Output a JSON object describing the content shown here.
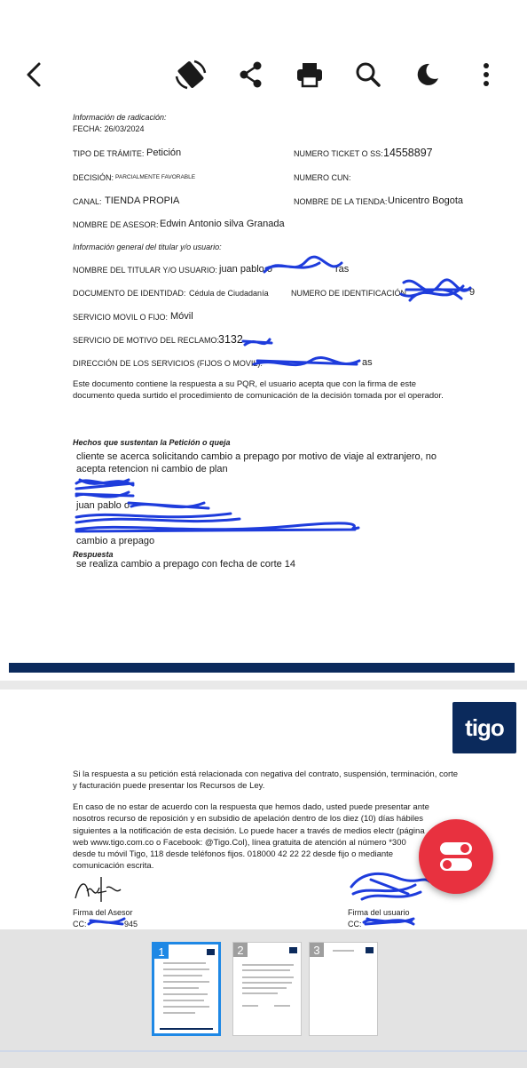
{
  "toolbar": {
    "icons": [
      "back-arrow-icon",
      "rotate-icon",
      "share-icon",
      "print-icon",
      "search-icon",
      "dark-mode-icon",
      "more-options-icon"
    ]
  },
  "doc": {
    "info_radicacion": "Información de radicación:",
    "fecha": "FECHA:  26/03/2024",
    "tipo_label": "TIPO DE TRÁMITE:",
    "tipo_value": "Petición",
    "ticket_label": "NUMERO TICKET O SS:",
    "ticket_value": "14558897",
    "decision_label": "DECISIÓN:",
    "decision_value": "PARCIALMENTE FAVORABLE",
    "cun_label": "NUMERO CUN:",
    "canal_label": "CANAL:",
    "canal_value": "TIENDA PROPIA",
    "tienda_label": "NOMBRE DE LA TIENDA:",
    "tienda_value": "Unicentro Bogota",
    "asesor_label": "NOMBRE DE ASESOR:",
    "asesor_value": "Edwin Antonio silva Granada",
    "info_general": "Información general del titular y/o usuario:",
    "titular_label": "NOMBRE DEL TITULAR Y/O USUARIO:",
    "titular_value": "juan pablo o",
    "titular_tail": "ras",
    "documento_label": "DOCUMENTO DE IDENTIDAD:",
    "documento_value": "Cédula de Ciudadanía",
    "identificacion_label": "NUMERO DE IDENTIFICACIÓN",
    "identificacion_tail": "9",
    "servicio_label": "SERVICIO MOVIL O FIJO:",
    "servicio_value": "Móvil",
    "motivo_label": "SERVICIO DE MOTIVO DEL RECLAMO:",
    "motivo_value": "3132",
    "direccion_label": "DIRECCIÓN DE LOS SERVICIOS (FIJOS O MOVIL):",
    "direccion_tail": "as",
    "paragraph": "Este documento contiene la respuesta a su PQR, el usuario acepta que con la firma de este documento queda surtido el procedimiento de comunicación de la decisión tomada por el operador.",
    "hechos_label": "Hechos que sustentan la Petición o queja",
    "hechos_line1": "cliente se acerca solicitando cambio a prepago por motivo de viaje al extranjero, no",
    "hechos_line2": "acepta retencion ni cambio de plan",
    "hechos_line3": "juan pablo o",
    "hechos_line4": "cambio a prepago",
    "respuesta_label": "Respuesta",
    "respuesta_value": "se realiza cambio a prepago con fecha de corte 14"
  },
  "page2": {
    "logo_text": "tigo",
    "para1": "Si la respuesta a su petición está relacionada con negativa del contrato, suspensión, terminación, corte y facturación puede presentar los Recursos de Ley.",
    "para2": "En caso de no estar de acuerdo con la respuesta que hemos dado, usted puede presentar ante nosotros recurso de reposición y en subsidio de apelación dentro de los diez (10) días hábiles siguientes a la notificación de esta decisión. Lo puede hacer a través de medios electr (página web www.tigo.com.co o Facebook: @Tigo.Col), línea gratuita de atención al número *300 desde tu móvil Tigo, 118 desde teléfonos fijos. 018000 42 22 22 desde fijo o mediante comunicación escrita.",
    "firma_asesor": "Firma del Asesor",
    "cc_asesor_prefix": "CC:",
    "cc_asesor_tail": "945",
    "firma_usuario": "Firma del usuario",
    "cc_usuario_prefix": "CC:"
  },
  "thumbnails": [
    {
      "number": "1",
      "active": true
    },
    {
      "number": "2",
      "active": false
    },
    {
      "number": "3",
      "active": false
    }
  ],
  "colors": {
    "accent_blue": "#1e88e5",
    "brand_navy": "#0b2a5c",
    "fab_red": "#e8313f",
    "redaction_blue": "#1e3cdc"
  }
}
